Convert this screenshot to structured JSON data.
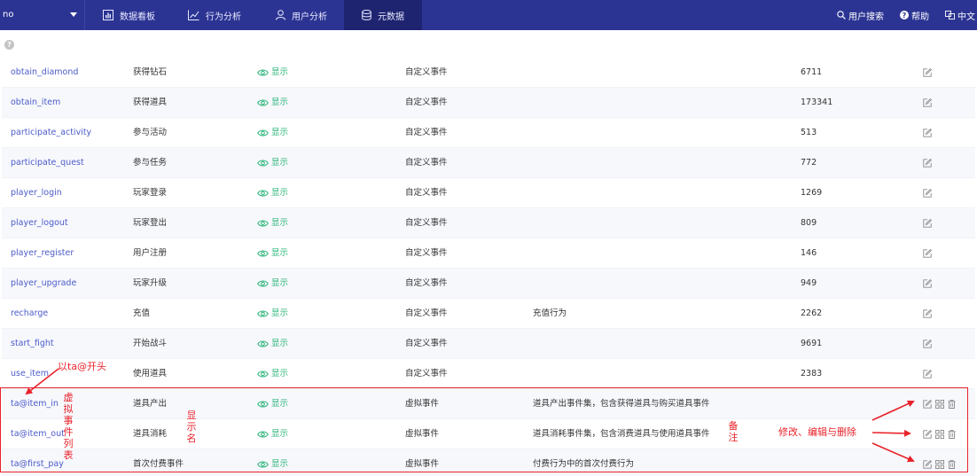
{
  "nav": {
    "project": "no",
    "items": [
      {
        "label": "数据看板",
        "icon": "bar-chart-icon"
      },
      {
        "label": "行为分析",
        "icon": "line-chart-icon"
      },
      {
        "label": "用户分析",
        "icon": "user-icon"
      },
      {
        "label": "元数据",
        "icon": "database-icon"
      }
    ],
    "active_index": 3,
    "right": {
      "user_search": "用户搜索",
      "help": "帮助",
      "language": "中文"
    }
  },
  "visible_label": "显示",
  "rows": [
    {
      "name": "obtain_diamond",
      "display": "获得钻石",
      "type": "自定义事件",
      "note": "",
      "count": "6711",
      "virtual": false
    },
    {
      "name": "obtain_item",
      "display": "获得道具",
      "type": "自定义事件",
      "note": "",
      "count": "173341",
      "virtual": false
    },
    {
      "name": "participate_activity",
      "display": "参与活动",
      "type": "自定义事件",
      "note": "",
      "count": "513",
      "virtual": false
    },
    {
      "name": "participate_quest",
      "display": "参与任务",
      "type": "自定义事件",
      "note": "",
      "count": "772",
      "virtual": false
    },
    {
      "name": "player_login",
      "display": "玩家登录",
      "type": "自定义事件",
      "note": "",
      "count": "1269",
      "virtual": false
    },
    {
      "name": "player_logout",
      "display": "玩家登出",
      "type": "自定义事件",
      "note": "",
      "count": "809",
      "virtual": false
    },
    {
      "name": "player_register",
      "display": "用户注册",
      "type": "自定义事件",
      "note": "",
      "count": "146",
      "virtual": false
    },
    {
      "name": "player_upgrade",
      "display": "玩家升级",
      "type": "自定义事件",
      "note": "",
      "count": "949",
      "virtual": false
    },
    {
      "name": "recharge",
      "display": "充值",
      "type": "自定义事件",
      "note": "充值行为",
      "count": "2262",
      "virtual": false
    },
    {
      "name": "start_fight",
      "display": "开始战斗",
      "type": "自定义事件",
      "note": "",
      "count": "9691",
      "virtual": false
    },
    {
      "name": "use_item",
      "display": "使用道具",
      "type": "自定义事件",
      "note": "",
      "count": "2383",
      "virtual": false
    },
    {
      "name": "ta@item_in",
      "display": "道具产出",
      "type": "虚拟事件",
      "note": "道具产出事件集，包含获得道具与购买道具事件",
      "count": "",
      "virtual": true
    },
    {
      "name": "ta@item_out",
      "display": "道具消耗",
      "type": "虚拟事件",
      "note": "道具消耗事件集，包含消费道具与使用道具事件",
      "count": "",
      "virtual": true
    },
    {
      "name": "ta@first_pay",
      "display": "首次付费事件",
      "type": "虚拟事件",
      "note": "付费行为中的首次付费行为",
      "count": "",
      "virtual": true
    }
  ],
  "annotations": {
    "prefix": "以ta@开头",
    "virtual_list": "虚拟事件列表",
    "display_name": "显示名",
    "note": "备注",
    "ops": "修改、编辑与删除"
  },
  "colors": {
    "nav_bg": "#2c3493",
    "nav_active": "#1e2470",
    "link": "#4b5bc9",
    "visible_green": "#2fb67c",
    "annotation_red": "#e8222a"
  }
}
